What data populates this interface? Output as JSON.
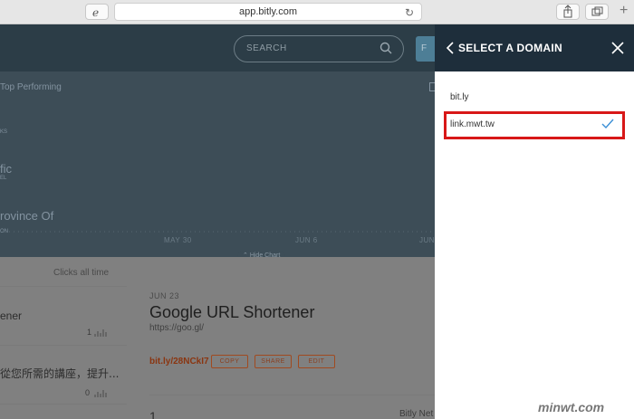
{
  "browser": {
    "url": "app.bitly.com"
  },
  "app": {
    "search_placeholder": "SEARCH",
    "cta_label": "F",
    "chart": {
      "top_performing": "Top Performing",
      "clicks_label": "KS",
      "row1_name": "fic",
      "row1_sub": "EL",
      "row2_name": "rovince Of",
      "row2_sub": "ON",
      "ticks": [
        "MAY 30",
        "JUN 6",
        "JUN"
      ],
      "hide_chart": "Hide Chart"
    },
    "list": {
      "clicks_all_time": "Clicks all time",
      "items": [
        {
          "title": "ener",
          "count": "1"
        },
        {
          "title": "從您所需的講座，提升...",
          "count": "0"
        }
      ],
      "third_count": "1"
    },
    "detail": {
      "date": "JUN 23",
      "title": "Google URL Shortener",
      "long_url": "https://goo.gl/",
      "short_link": "bit.ly/28NCkI7",
      "buttons": [
        "COPY",
        "SHARE",
        "EDIT"
      ],
      "footer": "Bitly Net"
    }
  },
  "panel": {
    "title": "SELECT A DOMAIN",
    "domains": [
      {
        "label": "bit.ly",
        "selected": false
      },
      {
        "label": "link.mwt.tw",
        "selected": true
      }
    ]
  },
  "watermark": "minwt.com",
  "colors": {
    "header": "#1e2e3b",
    "accent_red": "#d81818",
    "check": "#3b8fd6"
  }
}
